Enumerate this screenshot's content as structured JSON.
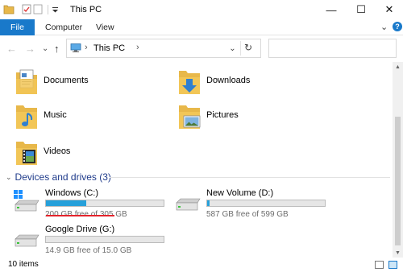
{
  "titlebar": {
    "title": "This PC",
    "quick_access_icons": [
      "folder-icon",
      "properties-icon",
      "new-folder-icon",
      "customize-dropdown-icon"
    ],
    "minimize_glyph": "—",
    "maximize_glyph": "☐",
    "close_glyph": "✕"
  },
  "ribbon": {
    "tabs": [
      {
        "label": "File",
        "active": true
      },
      {
        "label": "Computer"
      },
      {
        "label": "View"
      }
    ],
    "expand_glyph": "⌄",
    "help_glyph": "?",
    "accent": "#1979ca"
  },
  "nav": {
    "back_glyph": "←",
    "forward_glyph": "→",
    "recent_glyph": "⌄",
    "up_glyph": "↑"
  },
  "address": {
    "location": "This PC",
    "separator": "›",
    "dropdown_glyph": "⌄",
    "refresh_glyph": "↻"
  },
  "search": {
    "placeholder": ""
  },
  "folders": [
    {
      "name": "Documents",
      "icon": "documents-folder-icon"
    },
    {
      "name": "Downloads",
      "icon": "downloads-folder-icon"
    },
    {
      "name": "Music",
      "icon": "music-folder-icon"
    },
    {
      "name": "Pictures",
      "icon": "pictures-folder-icon"
    },
    {
      "name": "Videos",
      "icon": "videos-folder-icon"
    }
  ],
  "devices_section": {
    "label": "Devices and drives (3)",
    "chevron": "⌄"
  },
  "drives": [
    {
      "name": "Windows (C:)",
      "free_text": "200 GB free of 305 GB",
      "used_fraction": 0.344,
      "icon": "windows-drive-icon"
    },
    {
      "name": "New Volume (D:)",
      "free_text": "587 GB free of 599 GB",
      "used_fraction": 0.02,
      "icon": "hard-drive-icon"
    },
    {
      "name": "Google Drive (G:)",
      "free_text": "14.9 GB free of 15.0 GB",
      "used_fraction": 0.0,
      "icon": "hard-drive-icon"
    }
  ],
  "colors": {
    "drive_bar_fill": "#26a0da",
    "highlight_underline": "#e4232b",
    "section_heading": "#1e3a8a"
  },
  "statusbar": {
    "item_count": "10 items"
  }
}
